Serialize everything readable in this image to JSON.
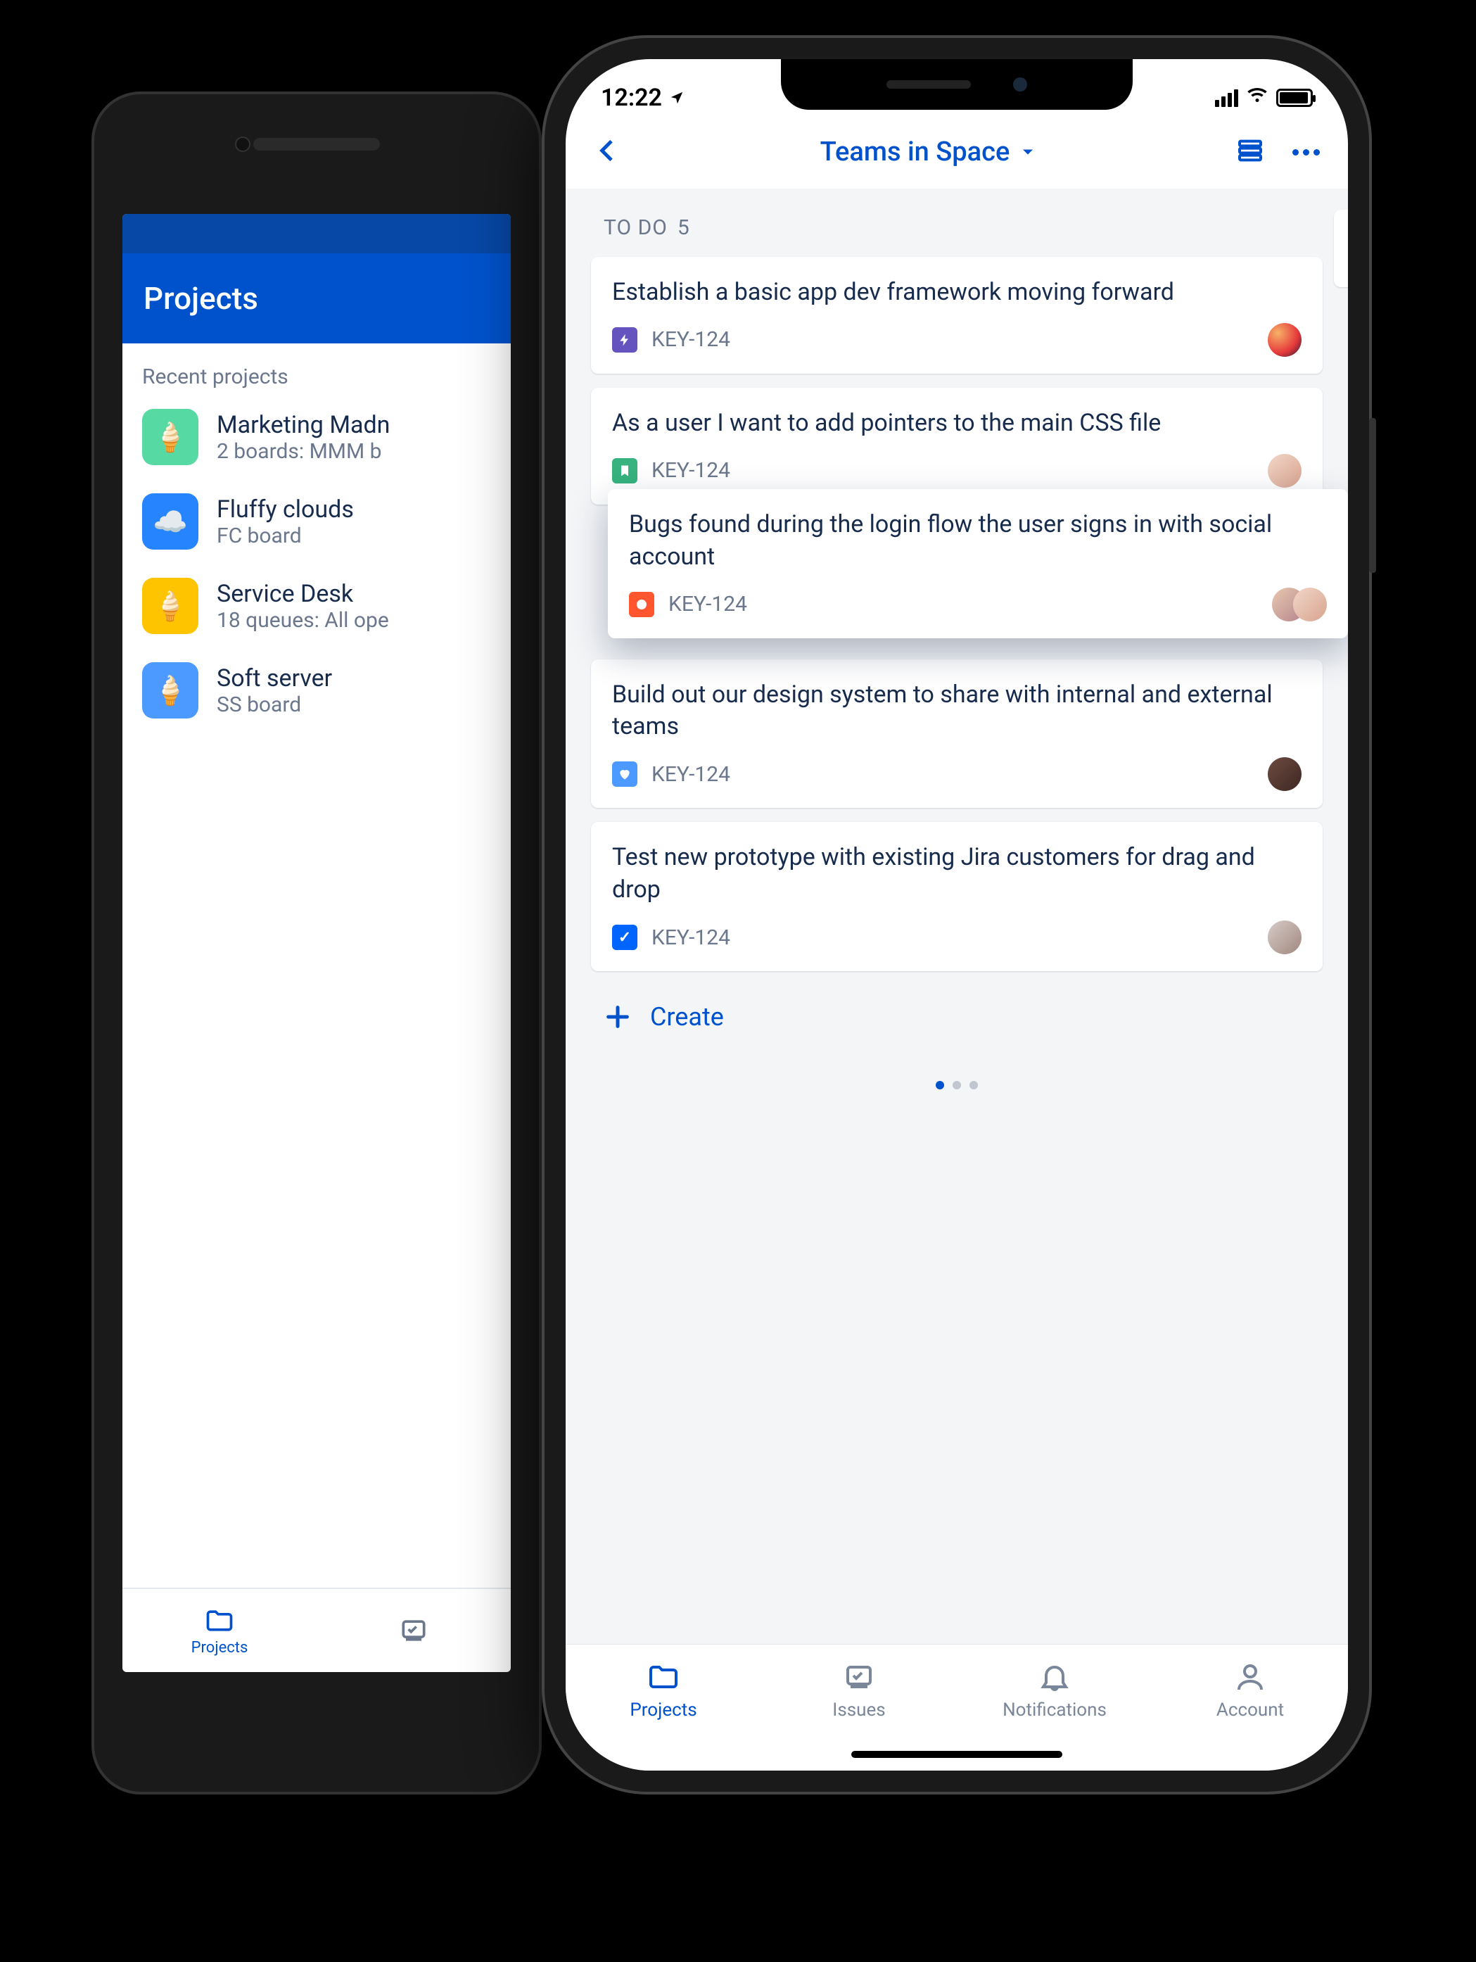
{
  "android": {
    "header_title": "Projects",
    "section_label": "Recent projects",
    "projects": [
      {
        "name": "Marketing Madn",
        "sub": "2 boards: MMM b",
        "icon_color": "green"
      },
      {
        "name": "Fluffy clouds",
        "sub": "FC board",
        "icon_color": "blue"
      },
      {
        "name": "Service Desk",
        "sub": "18 queues: All ope",
        "icon_color": "yellow"
      },
      {
        "name": "Soft server",
        "sub": "SS board",
        "icon_color": "blue2"
      }
    ],
    "tabs": {
      "projects": "Projects"
    }
  },
  "iphone": {
    "status_time": "12:22",
    "nav_title": "Teams in Space",
    "column": {
      "label": "TO DO",
      "count": "5"
    },
    "cards": [
      {
        "title": "Establish a basic app dev framework moving forward",
        "key": "KEY-124",
        "type": "epic",
        "avatar": "a1"
      },
      {
        "title": "As a user I want to add pointers to the main CSS file",
        "key": "KEY-124",
        "type": "story",
        "avatar": "a2"
      },
      {
        "title": "Bugs found during the login flow the user signs in with social account",
        "key": "KEY-124",
        "type": "bug",
        "avatar": "a3",
        "stacked": true
      },
      {
        "title": "Build out our design system to share with internal and external teams",
        "key": "KEY-124",
        "type": "feat",
        "avatar": "a4"
      },
      {
        "title": "Test new prototype with existing Jira customers for drag and drop",
        "key": "KEY-124",
        "type": "task",
        "avatar": "a5"
      }
    ],
    "create_label": "Create",
    "tabs": {
      "projects": "Projects",
      "issues": "Issues",
      "notifications": "Notifications",
      "account": "Account"
    }
  }
}
